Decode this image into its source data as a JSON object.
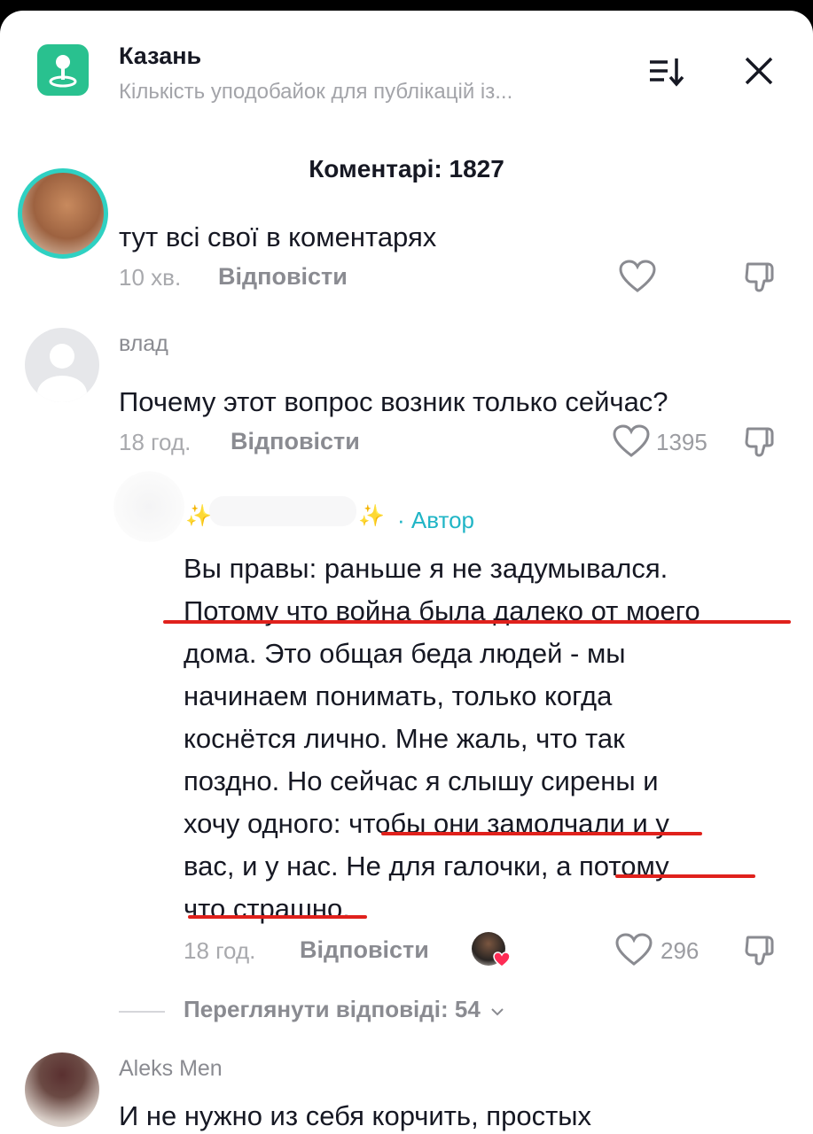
{
  "header": {
    "title": "Казань",
    "subtitle": "Кількість уподобайок для публікацій із...",
    "sort_icon": "sort-icon",
    "close_icon": "close-icon"
  },
  "comments_title": "Коментарі: 1827",
  "comments": [
    {
      "text": "тут всі свої в коментарях",
      "time": "10 хв.",
      "reply": "Відповісти",
      "likes": ""
    },
    {
      "username": "влад",
      "text": "Почему этот вопрос возник только сейчас?",
      "time": "18 год.",
      "reply": "Відповісти",
      "likes": "1395"
    }
  ],
  "author_reply": {
    "name_sparkle_left": "✨",
    "name_sparkle_right": "✨",
    "author_label": "· Автор",
    "lines": [
      "Вы правы: раньше я не задумывался.",
      "Потому что война была далеко от моего",
      "дома. Это общая беда людей - мы",
      "начинаем понимать, только когда",
      "коснётся лично. Мне жаль, что так",
      "поздно. Но сейчас я слышу сирены и",
      "хочу одного: чтобы они замолчали и у",
      "вас, и у нас. Не для галочки, а потому",
      "что страшно."
    ],
    "time": "18 год.",
    "reply": "Відповісти",
    "likes": "296",
    "highlight_color": "#e0211c"
  },
  "view_replies": "Переглянути відповіді: 54",
  "next_comment": {
    "username": "Aleks Men",
    "text": "И не нужно из себя корчить, простых"
  },
  "colors": {
    "accent_teal": "#29c18f",
    "author_label": "#20b5c6",
    "muted": "#a8a9ad"
  }
}
